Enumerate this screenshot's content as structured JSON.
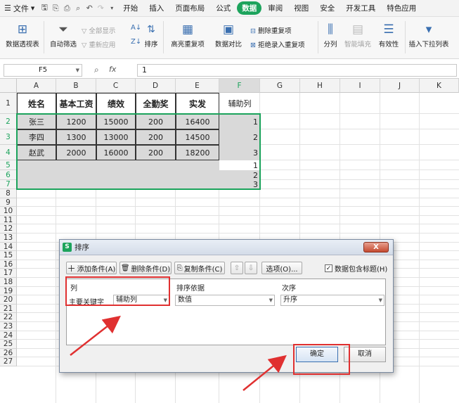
{
  "menubar": {
    "file_label": "文件",
    "tabs": [
      "开始",
      "插入",
      "页面布局",
      "公式",
      "数据",
      "审阅",
      "视图",
      "安全",
      "开发工具",
      "特色应用"
    ],
    "active_tab": "数据"
  },
  "toolbar": {
    "pivot": "数据透视表",
    "autofilter": "自动筛选",
    "show_all": "全部显示",
    "reapply": "重新应用",
    "sort": "排序",
    "highlight_dup": "高亮重复项",
    "data_compare": "数据对比",
    "remove_dup": "删除重复项",
    "reject_dup": "拒绝录入重复项",
    "split": "分列",
    "smart_fill": "智能填充",
    "validity": "有效性",
    "insert_dropdown": "插入下拉列表"
  },
  "formula_bar": {
    "name_box": "F5",
    "fx": "fx",
    "value": "1"
  },
  "columns": [
    "A",
    "B",
    "C",
    "D",
    "E",
    "F",
    "G",
    "H",
    "I",
    "J",
    "K"
  ],
  "rows": [
    "1",
    "2",
    "3",
    "4",
    "5",
    "6",
    "7",
    "8",
    "9",
    "10",
    "11",
    "12",
    "13",
    "14",
    "15",
    "16",
    "17",
    "18",
    "19",
    "20",
    "21",
    "22",
    "23",
    "24",
    "25",
    "26",
    "27"
  ],
  "table": {
    "headers": [
      "姓名",
      "基本工资",
      "绩效",
      "全勤奖",
      "实发",
      "辅助列"
    ],
    "rows": [
      [
        "张三",
        "1200",
        "15000",
        "200",
        "16400",
        "1"
      ],
      [
        "李四",
        "1300",
        "13000",
        "200",
        "14500",
        "2"
      ],
      [
        "赵武",
        "2000",
        "16000",
        "200",
        "18200",
        "3"
      ]
    ],
    "extra_f": [
      "1",
      "2",
      "3"
    ]
  },
  "dialog": {
    "title": "排序",
    "close": "X",
    "add_condition": "添加条件(A)",
    "delete_condition": "删除条件(D)",
    "copy_condition": "复制条件(C)",
    "move_up": "⇧",
    "move_down": "⇩",
    "options": "选项(O)...",
    "has_header_label": "数据包含标题(H)",
    "has_header_checked": "✓",
    "col_header": "列",
    "sort_on_header": "排序依据",
    "order_header": "次序",
    "primary_key_label": "主要关键字",
    "primary_key_value": "辅助列",
    "sort_on_value": "数值",
    "order_value": "升序",
    "ok": "确定",
    "cancel": "取消"
  },
  "colors": {
    "accent": "#1ca35c",
    "annotation": "#e03030"
  }
}
